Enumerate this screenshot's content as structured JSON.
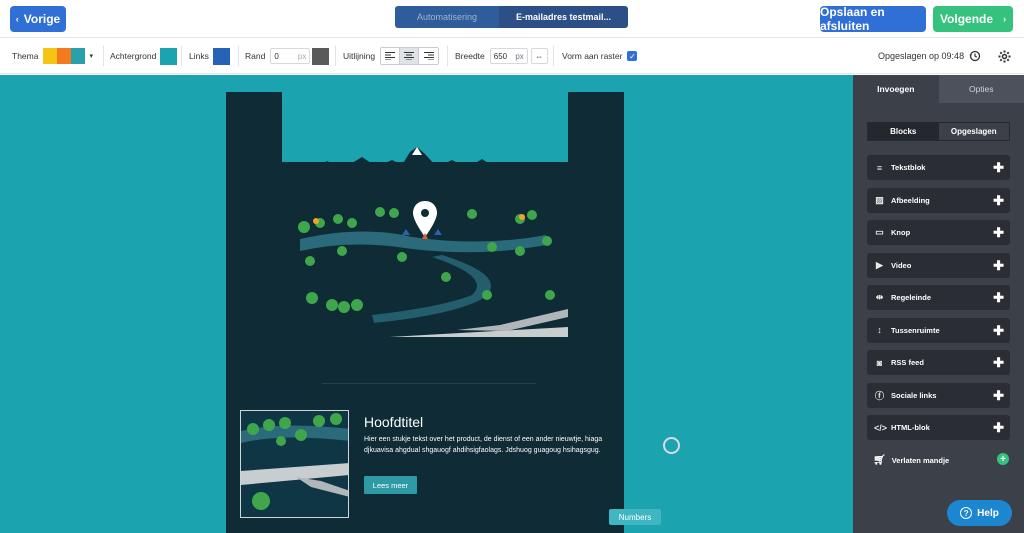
{
  "header": {
    "prev_label": "Vorige",
    "steps": [
      "Automatisering",
      "E-mailadres testmail..."
    ],
    "save_close_label": "Opslaan en afsluiten",
    "next_label": "Volgende"
  },
  "toolbar": {
    "theme_label": "Thema",
    "theme_colors": [
      "#f6c514",
      "#f37a1f",
      "#2aa0ad"
    ],
    "background_label": "Achtergrond",
    "background_color": "#1ba3b0",
    "links_label": "Links",
    "links_color": "#2463b8",
    "border_label": "Rand",
    "border_value": "0",
    "border_unit": "px",
    "border_color": "#5a5a5a",
    "align_label": "Uitlijning",
    "width_label": "Breedte",
    "width_value": "650",
    "width_unit": "px",
    "grid_label": "Vorm aan raster",
    "saved_text": "Opgeslagen op 09:48"
  },
  "email": {
    "headline": "Hoofdtitel",
    "body": "Hier een stukje tekst over het product, de dienst of een ander nieuwtje, hiaga djkuavisa ahgdual  shgauogf ahdihsigfaolags. Jdshuog guagoug hsihagsgug.",
    "button_label": "Lees meer"
  },
  "tooltip": "Numbers",
  "panel": {
    "tabs": [
      "Invoegen",
      "Opties"
    ],
    "subtabs": [
      "Blocks",
      "Opgeslagen"
    ],
    "blocks": [
      {
        "label": "Tekstblok",
        "icon": "text-lines-icon"
      },
      {
        "label": "Afbeelding",
        "icon": "image-icon"
      },
      {
        "label": "Knop",
        "icon": "button-icon"
      },
      {
        "label": "Video",
        "icon": "play-icon"
      },
      {
        "label": "Regeleinde",
        "icon": "divider-icon"
      },
      {
        "label": "Tussenruimte",
        "icon": "spacer-icon"
      },
      {
        "label": "RSS feed",
        "icon": "rss-icon"
      },
      {
        "label": "Sociale links",
        "icon": "facebook-icon"
      },
      {
        "label": "HTML-blok",
        "icon": "code-icon"
      }
    ],
    "cart_label": "Verlaten mandje"
  },
  "help_label": "Help"
}
